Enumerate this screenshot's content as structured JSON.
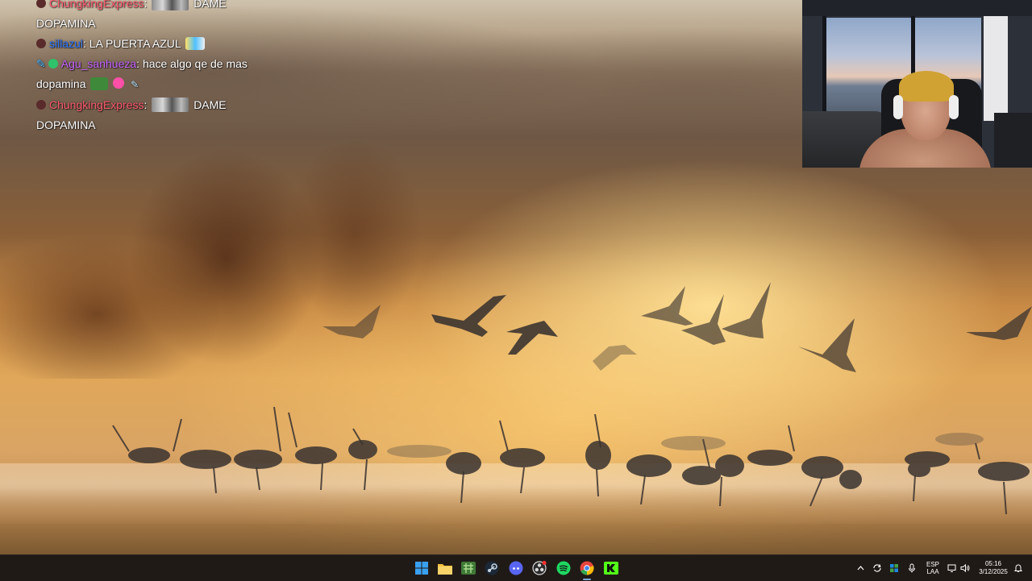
{
  "chat": {
    "messages": [
      {
        "user": "ChungkingExpress",
        "user_color": "#ff5a6e",
        "text_after_emote": "DAME",
        "continuation": "DOPAMINA"
      },
      {
        "user": "sillazul",
        "user_color": "#2a76ff",
        "text": "LA PUERTA AZUL"
      },
      {
        "user": "Agu_sanhueza",
        "user_color": "#c564ff",
        "text": "hace algo qe de mas",
        "continuation": "dopamina"
      },
      {
        "user": "ChungkingExpress",
        "user_color": "#ff5a6e",
        "text_after_emote": "DAME",
        "continuation": "DOPAMINA"
      }
    ],
    "separator": ":"
  },
  "taskbar": {
    "pinned": [
      {
        "name": "start-button",
        "icon": "windows-logo-icon",
        "color": "#3aa0f0"
      },
      {
        "name": "file-explorer",
        "icon": "folder-icon",
        "color": "#f3c33e"
      },
      {
        "name": "game-app",
        "icon": "game-icon",
        "color": "#5aa350"
      },
      {
        "name": "steam",
        "icon": "steam-icon",
        "color": "#c7d5e0"
      },
      {
        "name": "discord",
        "icon": "discord-icon",
        "color": "#5865f2"
      },
      {
        "name": "obs",
        "icon": "obs-icon",
        "color": "#d8d8d8"
      },
      {
        "name": "spotify",
        "icon": "spotify-icon",
        "color": "#1ed760"
      },
      {
        "name": "chrome",
        "icon": "chrome-icon",
        "color": "#e8453c"
      },
      {
        "name": "kick",
        "icon": "kick-icon",
        "color": "#53fc18"
      }
    ],
    "tray": {
      "language_line1": "ESP",
      "language_line2": "LAA",
      "time": "05:16",
      "date": "3/12/2025"
    }
  }
}
